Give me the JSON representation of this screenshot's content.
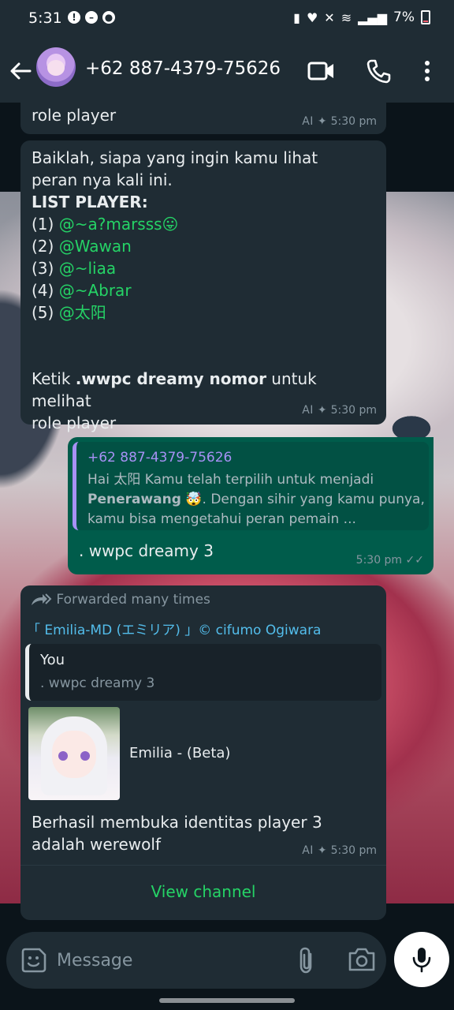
{
  "status_bar": {
    "time": "5:31",
    "battery": "7%"
  },
  "header": {
    "contact_name": "+62 887-4379-75626"
  },
  "messages": {
    "m1": {
      "text": "role player",
      "ai_badge": "AI ✦",
      "time": "5:30 pm"
    },
    "m2": {
      "intro_line1": "Baiklah, siapa yang ingin kamu lihat",
      "intro_line2": "peran nya kali ini.",
      "list_title": "LIST PLAYER:",
      "players": [
        {
          "num": "(1)",
          "name": "@~a?marsss😛"
        },
        {
          "num": "(2)",
          "name": "@Wawan"
        },
        {
          "num": "(3)",
          "name": "@~liaa"
        },
        {
          "num": "(4)",
          "name": "@~Abrar"
        },
        {
          "num": "(5)",
          "name": "@太阳"
        }
      ],
      "instruction_prefix": "Ketik ",
      "instruction_bold": ".wwpc dreamy nomor",
      "instruction_suffix": " untuk melihat",
      "instruction_line2": "role player",
      "ai_badge": "AI ✦",
      "time": "5:30 pm"
    },
    "m3": {
      "quote_author": "+62 887-4379-75626",
      "quote_part1": "Hai 太阳 Kamu telah terpilih  untuk menjadi ",
      "quote_bold": "Penerawang",
      "quote_part2": " 🤯. Dengan sihir yang kamu punya, kamu bisa mengetahui peran pemain ...",
      "text": ". wwpc dreamy 3",
      "time": "5:30 pm",
      "ticks": "✓✓"
    },
    "m4": {
      "forwarded": "Forwarded many times",
      "channel": "「 Emilia-MD (エミリア) 」© cifumo Ogiwara",
      "quote_author": "You",
      "quote_text": ". wwpc dreamy 3",
      "preview_title": "Emilia - (Beta)",
      "text_line1": "Berhasil membuka identitas player 3",
      "text_line2": "adalah werewolf",
      "ai_badge": "AI ✦",
      "time": "5:30 pm",
      "view_channel": "View channel"
    }
  },
  "composer": {
    "placeholder": "Message"
  },
  "colors": {
    "header_bg": "#1f2c34",
    "incoming_bubble": "#1f2c34",
    "outgoing_bubble": "#005c4b",
    "accent_green": "#25d366",
    "link_blue": "#53bdeb"
  }
}
